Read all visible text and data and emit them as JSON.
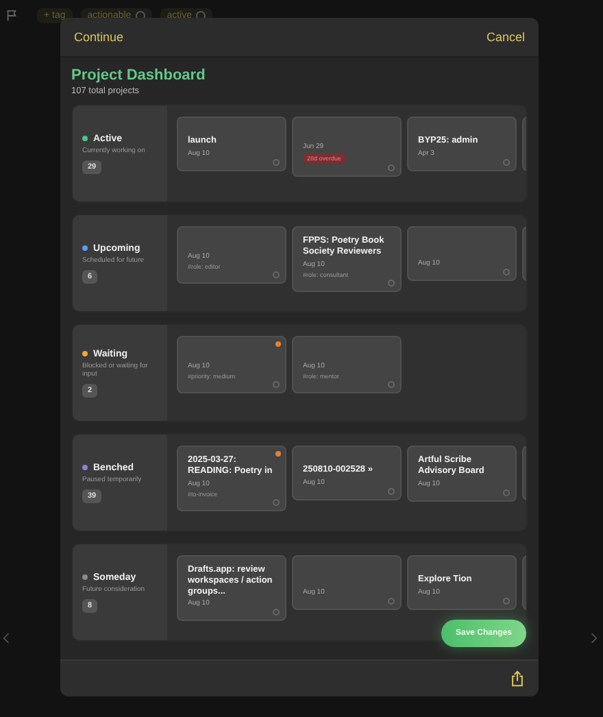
{
  "background": {
    "tags": [
      {
        "label": "+ tag",
        "removable": false
      },
      {
        "label": "actionable",
        "removable": true
      },
      {
        "label": "active",
        "removable": true
      }
    ]
  },
  "header": {
    "continue": "Continue",
    "cancel": "Cancel"
  },
  "title": "Project Dashboard",
  "subtitle": "107 total projects",
  "sections": [
    {
      "name": "Active",
      "description": "Currently working on",
      "count": "29",
      "color": "#4cc38a",
      "cards": [
        {
          "title": "launch",
          "date": "Aug 10",
          "flagged": false
        },
        {
          "date": "Jun 29",
          "badge": "28d overdue",
          "flagged": false
        },
        {
          "title": "BYP25: admin",
          "date": "Apr 3",
          "flagged": false
        }
      ]
    },
    {
      "name": "Upcoming",
      "description": "Scheduled for future",
      "count": "6",
      "color": "#5b9bf0",
      "cards": [
        {
          "date": "Aug 10",
          "tag": "#role: editor",
          "flagged": false
        },
        {
          "title": "FPPS: Poetry Book Society Reviewers",
          "date": "Aug 10",
          "tag": "#role: consultant",
          "flagged": false
        },
        {
          "date": "Aug 10",
          "flagged": false
        }
      ]
    },
    {
      "name": "Waiting",
      "description": "Blocked or waiting for input",
      "count": "2",
      "color": "#f0a830",
      "cards": [
        {
          "date": "Aug 10",
          "tag": "#priority: medium",
          "flagged": true
        },
        {
          "date": "Aug 10",
          "tag": "#role: mentor",
          "flagged": false
        }
      ]
    },
    {
      "name": "Benched",
      "description": "Paused temporarily",
      "count": "39",
      "color": "#8e7fd8",
      "cards": [
        {
          "title": "2025-03-27: READING: Poetry in",
          "date": "Aug 10",
          "tag": "#to-invoice",
          "flagged": true
        },
        {
          "title": "250810-002528 »",
          "date": "Aug 10",
          "flagged": false
        },
        {
          "title": "Artful Scribe Advisory Board",
          "date": "Aug 10",
          "flagged": false
        }
      ]
    },
    {
      "name": "Someday",
      "description": "Future consideration",
      "count": "8",
      "color": "#8a8a8a",
      "cards": [
        {
          "title": "Drafts.app: review workspaces / action groups...",
          "date": "Aug 10",
          "flagged": false
        },
        {
          "date": "Aug 10",
          "flagged": false
        },
        {
          "title": "Explore Tion",
          "date": "Aug 10",
          "flagged": false
        }
      ]
    }
  ],
  "save_button": "Save Changes"
}
